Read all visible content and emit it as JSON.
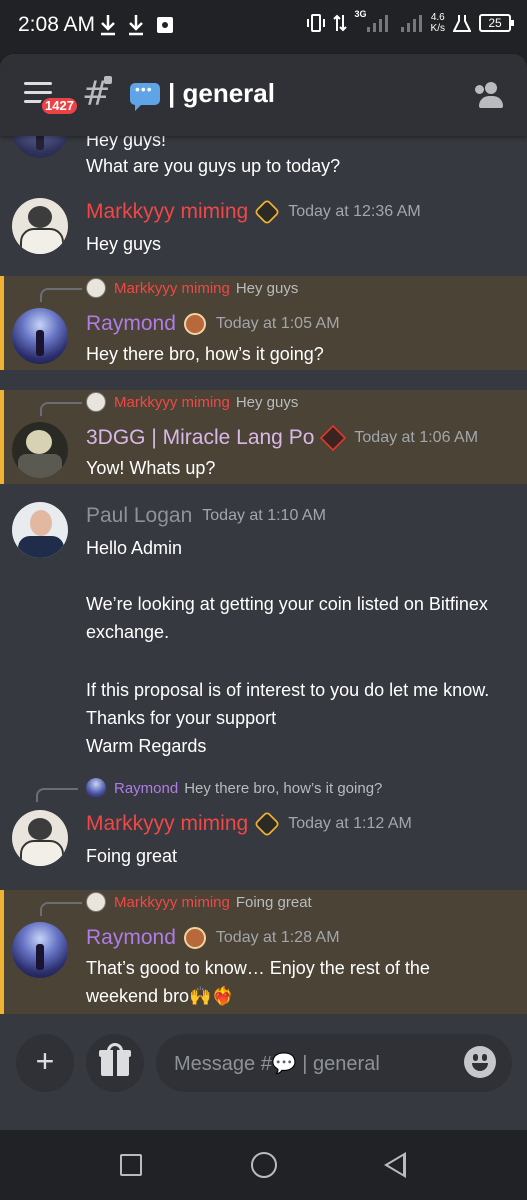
{
  "status_bar": {
    "time": "2:08 AM",
    "network": "3G",
    "speed": "4.6",
    "speed_unit": "K/s",
    "battery": "25",
    "left_icons": [
      "download-icon",
      "download-icon",
      "app-notification-icon"
    ],
    "right_icons": [
      "vibrate-icon",
      "data-arrows-icon",
      "signal-icon",
      "signal-icon",
      "lab-icon",
      "battery-icon"
    ]
  },
  "header": {
    "badge_count": "1427",
    "channel_prefix_icon": "speech-bubble-icon",
    "channel_name": "general"
  },
  "messages": [
    {
      "type": "continuation",
      "partial_line": "Hey guys!",
      "text": "What are you guys up  to today?"
    },
    {
      "type": "message",
      "author": "Markkyyy miming",
      "timestamp": "Today at 12:36 AM",
      "text": "Hey guys"
    },
    {
      "type": "reply",
      "reply_to": {
        "author": "Markkyyy miming",
        "text": "Hey guys"
      },
      "author": "Raymond",
      "timestamp": "Today at 1:05 AM",
      "text": "Hey there bro, how’s it going?"
    },
    {
      "type": "reply",
      "reply_to": {
        "author": "Markkyyy miming",
        "text": "Hey guys"
      },
      "author": "3DGG | Miracle Lang Po",
      "timestamp": "Today at 1:06 AM",
      "text": "Yow! Whats up?"
    },
    {
      "type": "message",
      "author": "Paul Logan",
      "timestamp": "Today at 1:10 AM",
      "lines": [
        "Hello Admin",
        "",
        "We’re looking at getting your coin listed on Bitfinex",
        "exchange.",
        "",
        "If this proposal is of interest to you do let me know.",
        "Thanks for your support",
        "Warm Regards"
      ]
    },
    {
      "type": "reply",
      "reply_to": {
        "author": "Raymond",
        "text": "Hey there bro, how’s it going?"
      },
      "author": "Markkyyy miming",
      "timestamp": "Today at 1:12 AM",
      "text": "Foing great"
    },
    {
      "type": "reply",
      "reply_to": {
        "author": "Markkyyy miming",
        "text": "Foing great"
      },
      "author": "Raymond",
      "timestamp": "Today at 1:28 AM",
      "lines": [
        "That’s good to know… Enjoy the rest of the",
        "weekend bro🙌❤️‍🔥"
      ]
    }
  ],
  "composer": {
    "placeholder": "Message #💬 | general"
  },
  "colors": {
    "markkyyy": "#f04747",
    "raymond": "#b07ce6",
    "3dgg": "#d9b8e8",
    "paul": "#8e9297",
    "mention_highlight": "#4a4336",
    "mention_bar": "#f0b232"
  }
}
